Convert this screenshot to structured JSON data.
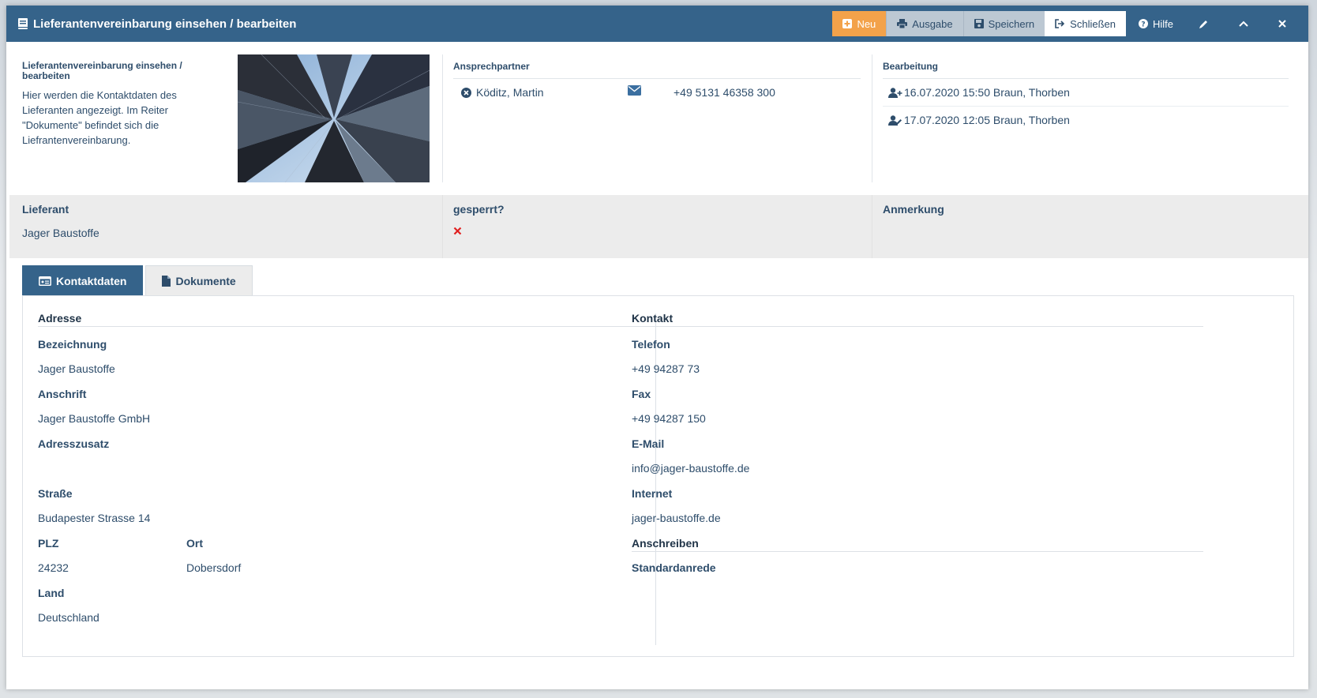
{
  "window": {
    "title": "Lieferantenvereinbarung einsehen / bearbeiten",
    "toolbar": {
      "neu": "Neu",
      "ausgabe": "Ausgabe",
      "speichern": "Speichern",
      "schliessen": "Schließen",
      "hilfe": "Hilfe"
    }
  },
  "intro": {
    "heading": "Lieferantenvereinbarung einsehen / bearbeiten",
    "text": "Hier werden die Kontaktdaten des Lieferanten angezeigt. Im Reiter \"Dokumente\" befindet sich die Liefrantenvereinbarung."
  },
  "ansprechpartner": {
    "label": "Ansprechpartner",
    "name": "Köditz, Martin",
    "phone": "+49 5131 46358 300"
  },
  "bearbeitung": {
    "label": "Bearbeitung",
    "created": "16.07.2020 15:50 Braun, Thorben",
    "edited": "17.07.2020 12:05 Braun, Thorben"
  },
  "summary": {
    "lieferant_label": "Lieferant",
    "lieferant_value": "Jager Baustoffe",
    "gesperrt_label": "gesperrt?",
    "anmerkung_label": "Anmerkung",
    "anmerkung_value": ""
  },
  "tabs": [
    {
      "label": "Kontaktdaten",
      "active": true
    },
    {
      "label": "Dokumente",
      "active": false
    }
  ],
  "adresse": {
    "heading": "Adresse",
    "bezeichnung_label": "Bezeichnung",
    "bezeichnung": "Jager Baustoffe",
    "anschrift_label": "Anschrift",
    "anschrift": "Jager Baustoffe GmbH",
    "adresszusatz_label": "Adresszusatz",
    "adresszusatz": "",
    "strasse_label": "Straße",
    "strasse": "Budapester Strasse 14",
    "plz_label": "PLZ",
    "plz": "24232",
    "ort_label": "Ort",
    "ort": "Dobersdorf",
    "land_label": "Land",
    "land": "Deutschland"
  },
  "kontakt": {
    "heading": "Kontakt",
    "telefon_label": "Telefon",
    "telefon": "+49 94287 73",
    "fax_label": "Fax",
    "fax": "+49 94287 150",
    "email_label": "E-Mail",
    "email": "info@jager-baustoffe.de",
    "internet_label": "Internet",
    "internet": "jager-baustoffe.de",
    "anschreiben_heading": "Anschreiben",
    "standardanrede_label": "Standardanrede",
    "standardanrede": ""
  },
  "colors": {
    "primary": "#35638a",
    "accent": "#f3a24a",
    "danger": "#e02020"
  },
  "icons": {
    "title": "book-icon",
    "neu": "plus-square-icon",
    "ausgabe": "print-icon",
    "speichern": "save-icon",
    "schliessen": "sign-out-icon",
    "hilfe": "question-circle-icon",
    "edit": "pencil-icon",
    "collapse": "chevron-up-icon",
    "close": "close-icon",
    "contact_remove": "times-circle-icon",
    "email": "envelope-icon",
    "created": "user-plus-icon",
    "edited": "user-edit-icon",
    "blocked": "cross-icon",
    "kontaktdaten": "id-card-icon",
    "dokumente": "file-icon"
  }
}
